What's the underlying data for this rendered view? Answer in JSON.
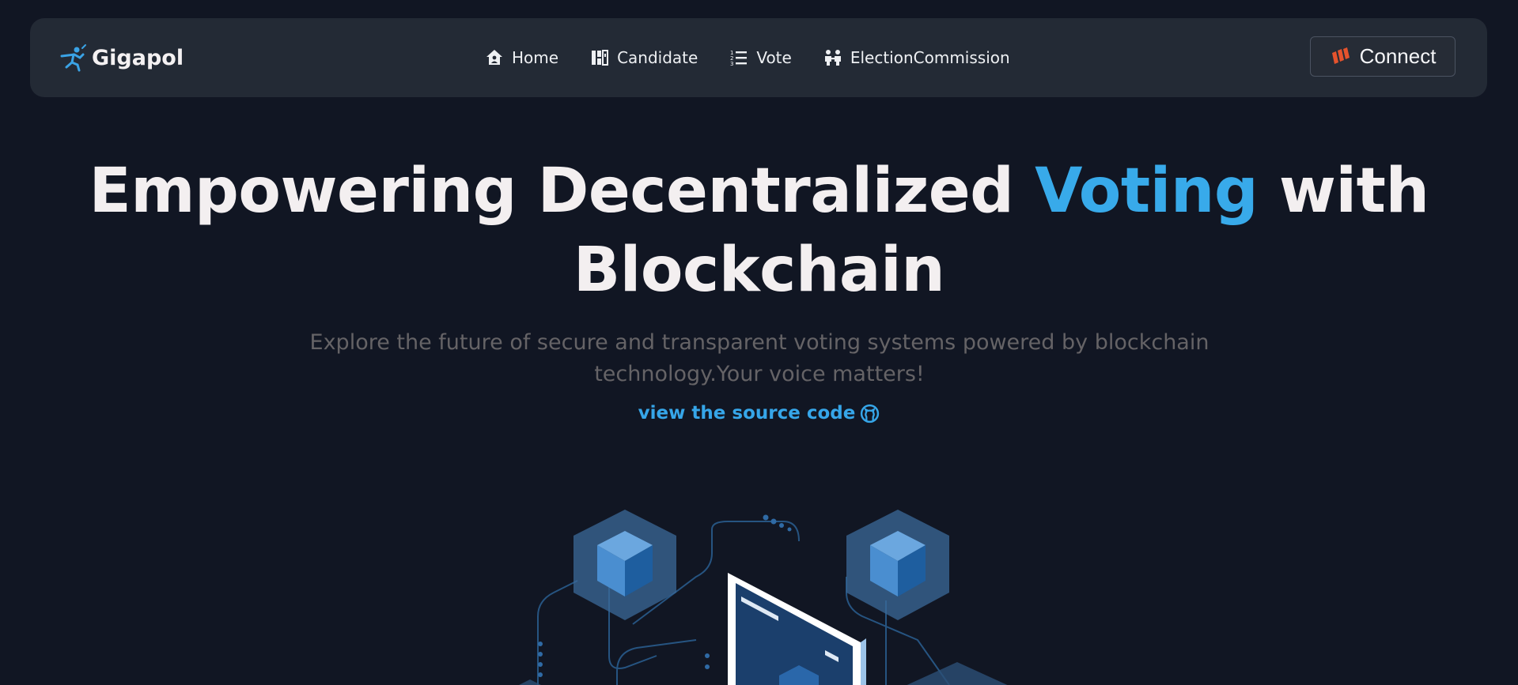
{
  "brand": {
    "name": "Gigapol",
    "icon": "runner-logo-icon"
  },
  "nav": {
    "items": [
      {
        "label": "Home",
        "icon": "home-icon"
      },
      {
        "label": "Candidate",
        "icon": "candidate-icon"
      },
      {
        "label": "Vote",
        "icon": "list-icon"
      },
      {
        "label": "ElectionCommission",
        "icon": "people-icon"
      }
    ],
    "connect_label": "Connect",
    "connect_icon": "wallet-logo-icon"
  },
  "hero": {
    "title_part1": "Empowering Decentralized",
    "title_accent": "Voting",
    "title_part2": "with",
    "title_line2": "Blockchain",
    "subtitle": "Explore the future of secure and transparent voting systems powered by blockchain technology.Your voice matters!",
    "source_link": "view the source code",
    "source_icon": "github-icon"
  },
  "colors": {
    "background": "#111623",
    "navbar": "#232a35",
    "accent": "#38aaea",
    "connect_logo": "#e5532d"
  }
}
